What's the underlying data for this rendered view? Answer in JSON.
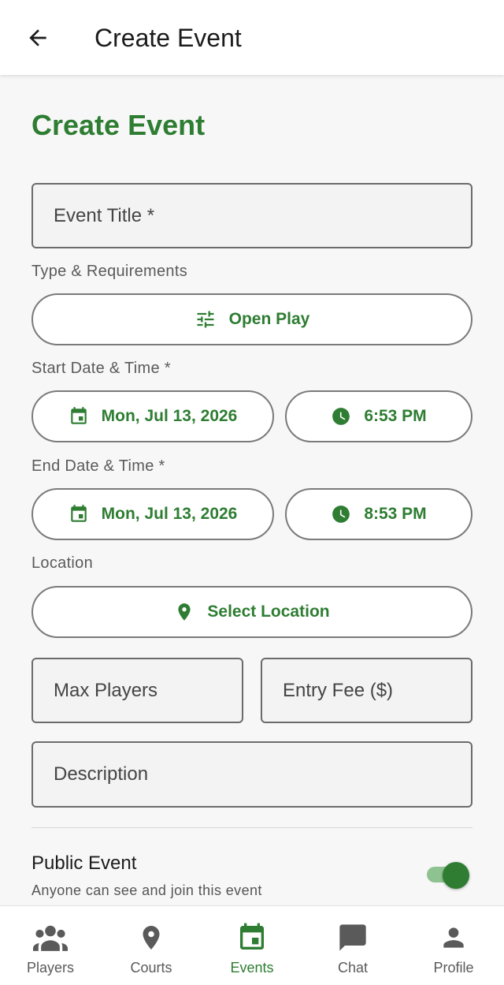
{
  "appbar": {
    "title": "Create Event"
  },
  "page": {
    "heading": "Create Event"
  },
  "form": {
    "event_title": {
      "placeholder": "Event Title *",
      "value": ""
    },
    "type_label": "Type & Requirements",
    "type_value": "Open Play",
    "start_label": "Start Date & Time *",
    "start_date": "Mon, Jul 13, 2026",
    "start_time": "6:53 PM",
    "end_label": "End Date & Time *",
    "end_date": "Mon, Jul 13, 2026",
    "end_time": "8:53 PM",
    "location_label": "Location",
    "location_button": "Select Location",
    "max_players": {
      "placeholder": "Max Players",
      "value": ""
    },
    "entry_fee": {
      "placeholder": "Entry Fee ($)",
      "value": ""
    },
    "description": {
      "placeholder": "Description",
      "value": ""
    },
    "public_event": {
      "title": "Public Event",
      "subtitle": "Anyone can see and join this event",
      "enabled": true
    }
  },
  "bottom_nav": {
    "items": [
      {
        "label": "Players",
        "icon": "people-icon",
        "active": false
      },
      {
        "label": "Courts",
        "icon": "location-pin-icon",
        "active": false
      },
      {
        "label": "Events",
        "icon": "calendar-icon",
        "active": true
      },
      {
        "label": "Chat",
        "icon": "chat-icon",
        "active": false
      },
      {
        "label": "Profile",
        "icon": "person-icon",
        "active": false
      }
    ]
  },
  "colors": {
    "accent": "#2e7d32",
    "toggle_track": "#8fc291",
    "inactive_nav": "#5a5a5a"
  }
}
